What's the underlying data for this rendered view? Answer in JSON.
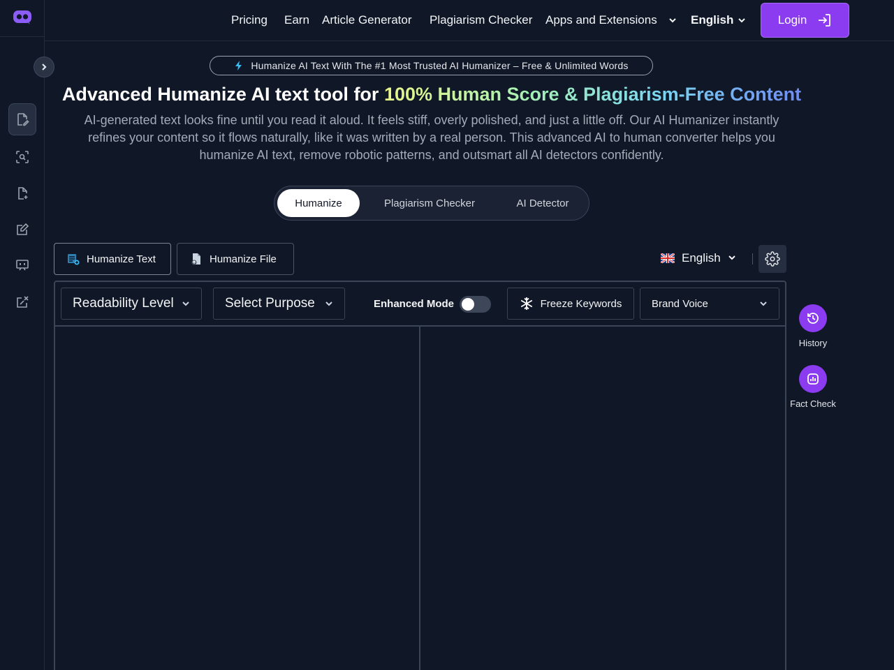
{
  "nav": {
    "links": [
      "Pricing",
      "Earn",
      "Article Generator",
      "Plagiarism Checker",
      "Apps and Extensions"
    ],
    "language": "English",
    "login": "Login"
  },
  "hero": {
    "promo": "Humanize AI Text With The #1 Most Trusted AI Humanizer – Free & Unlimited Words",
    "title_plain": "Advanced Humanize AI text tool for ",
    "title_highlight": "100% Human Score & Plagiarism-Free Content",
    "description": "AI-generated text looks fine until you read it aloud. It feels stiff, overly polished, and just a little off. Our AI Humanizer instantly refines your content so it flows naturally, like it was written by a real person. This advanced AI to human converter helps you humanize AI text, remove robotic patterns, and outsmart all AI detectors confidently."
  },
  "mode_tabs": [
    "Humanize",
    "Plagiarism Checker",
    "AI Detector"
  ],
  "source": {
    "text_label": "Humanize Text",
    "file_label": "Humanize File",
    "language": "English"
  },
  "toolbar": {
    "readability": "Readability Level",
    "purpose": "Select Purpose",
    "enhanced_mode": "Enhanced Mode",
    "freeze_keywords": "Freeze Keywords",
    "brand_voice": "Brand Voice"
  },
  "side_actions": {
    "history": "History",
    "fact_check": "Fact Check"
  },
  "colors": {
    "background": "#101727",
    "accent": "#8b3cf0",
    "border": "#3a4558"
  },
  "states": {
    "enhanced_mode_on": false,
    "active_mode_tab": "Humanize",
    "active_source": "Humanize Text"
  }
}
